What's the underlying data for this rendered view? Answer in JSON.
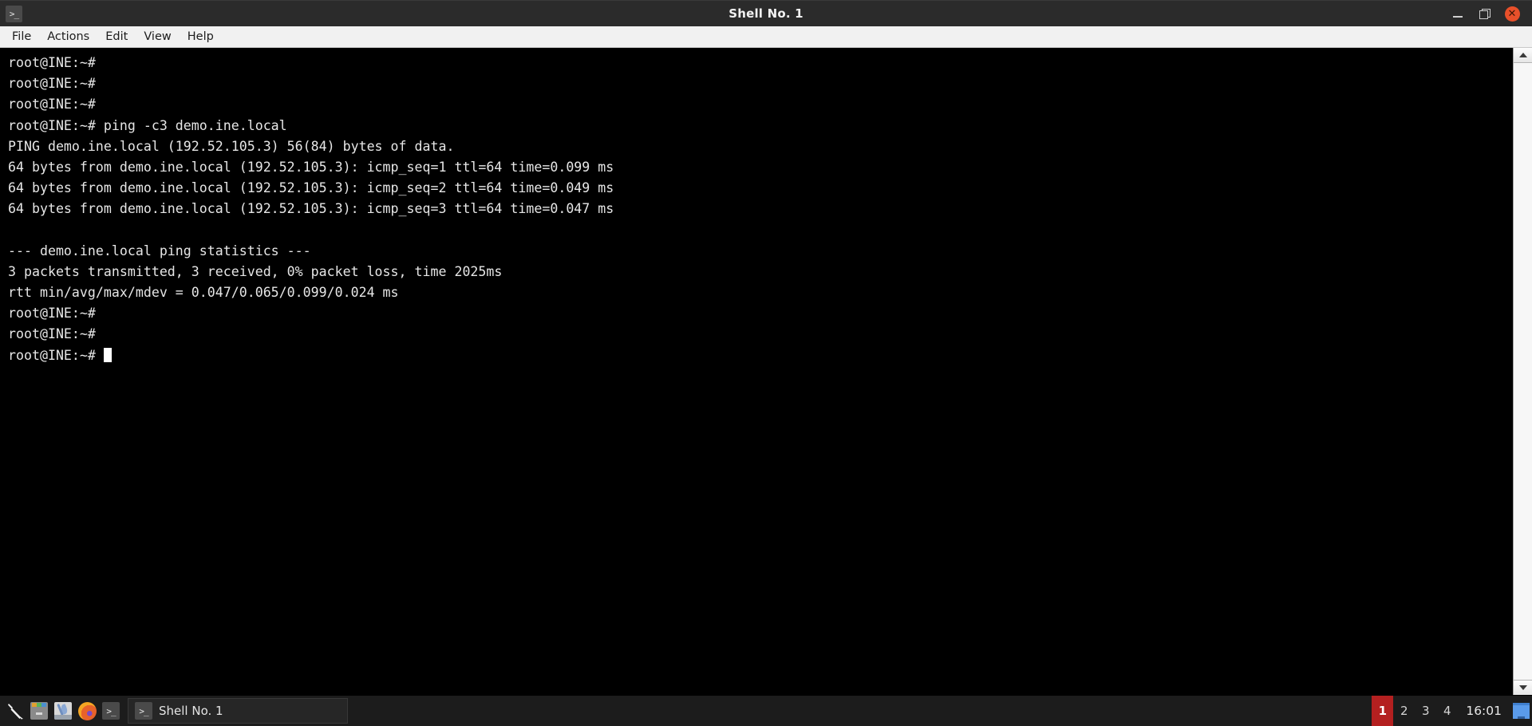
{
  "window": {
    "title": "Shell No. 1",
    "icon": "terminal-icon",
    "controls": {
      "minimize": "_",
      "maximize": "❐",
      "close": "×"
    }
  },
  "menubar": {
    "items": [
      {
        "label": "File"
      },
      {
        "label": "Actions"
      },
      {
        "label": "Edit"
      },
      {
        "label": "View"
      },
      {
        "label": "Help"
      }
    ]
  },
  "terminal": {
    "prompt": "root@INE:~#",
    "command": "ping -c3 demo.ine.local",
    "host": "demo.ine.local",
    "ip": "192.52.105.3",
    "lines": [
      "root@INE:~#",
      "root@INE:~#",
      "root@INE:~#",
      "root@INE:~# ping -c3 demo.ine.local",
      "PING demo.ine.local (192.52.105.3) 56(84) bytes of data.",
      "64 bytes from demo.ine.local (192.52.105.3): icmp_seq=1 ttl=64 time=0.099 ms",
      "64 bytes from demo.ine.local (192.52.105.3): icmp_seq=2 ttl=64 time=0.049 ms",
      "64 bytes from demo.ine.local (192.52.105.3): icmp_seq=3 ttl=64 time=0.047 ms",
      "",
      "--- demo.ine.local ping statistics ---",
      "3 packets transmitted, 3 received, 0% packet loss, time 2025ms",
      "rtt min/avg/max/mdev = 0.047/0.065/0.099/0.024 ms",
      "root@INE:~#",
      "root@INE:~#"
    ],
    "last_prompt": "root@INE:~# ",
    "colors": {
      "background": "#000000",
      "foreground": "#e6e6e6",
      "cursor": "#ffffff"
    }
  },
  "scrollbar": {
    "up_arrow": "▲",
    "down_arrow": "▼"
  },
  "taskbar": {
    "launchers": [
      {
        "name": "applications-menu",
        "glyph": ""
      },
      {
        "name": "file-manager",
        "glyph": ""
      },
      {
        "name": "text-editor",
        "glyph": ""
      },
      {
        "name": "firefox",
        "glyph": ""
      },
      {
        "name": "terminal",
        "glyph": ">_"
      }
    ],
    "task_buttons": [
      {
        "label": "Shell No. 1",
        "icon": ">_",
        "active": true
      }
    ],
    "workspaces": [
      {
        "label": "1",
        "active": true
      },
      {
        "label": "2",
        "active": false
      },
      {
        "label": "3",
        "active": false
      },
      {
        "label": "4",
        "active": false
      }
    ],
    "clock": "16:01",
    "show_desktop": "show-desktop",
    "colors": {
      "background": "#1c1c1c",
      "active_workspace": "#b42020",
      "desktop_icon": "#5a9bea"
    }
  }
}
